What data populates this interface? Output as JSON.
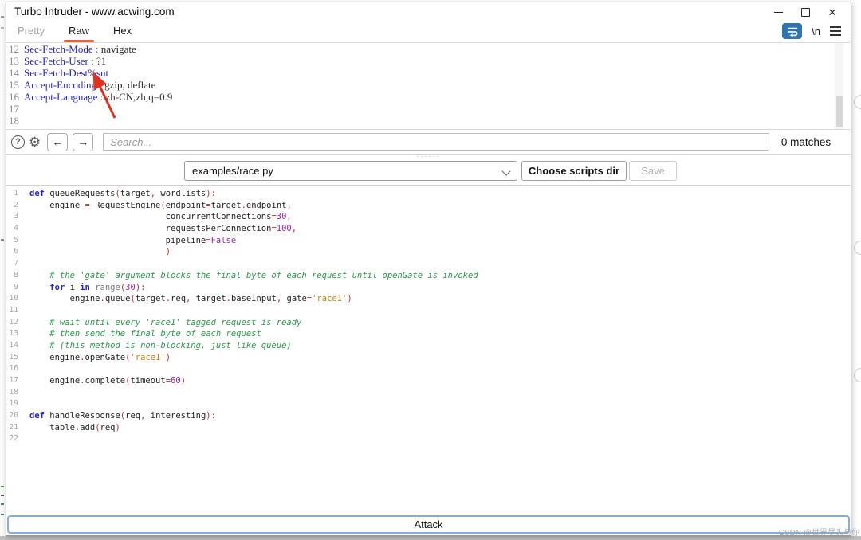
{
  "window": {
    "title": "Turbo Intruder - www.acwing.com"
  },
  "tabs": [
    {
      "label": "Pretty",
      "state": "dim"
    },
    {
      "label": "Raw",
      "state": "active"
    },
    {
      "label": "Hex",
      "state": "normal"
    }
  ],
  "toolbar": {
    "newline_label": "\\n"
  },
  "request_editor": {
    "lines": [
      {
        "num": "12",
        "name": "Sec-Fetch-Mode",
        "sep": " : ",
        "value": "navigate"
      },
      {
        "num": "13",
        "name": "Sec-Fetch-User",
        "sep": " : ",
        "value": "?1"
      },
      {
        "num": "14",
        "name": "Sec-Fetch-Dest%snt",
        "sep": "",
        "value": ""
      },
      {
        "num": "15",
        "name": "Accept-Encoding",
        "sep": " : ",
        "value": "gzip, deflate"
      },
      {
        "num": "16",
        "name": "Accept-Language",
        "sep": " : ",
        "value": "zh-CN,zh;q=0.9"
      },
      {
        "num": "17",
        "name": "",
        "sep": "",
        "value": ""
      },
      {
        "num": "18",
        "name": "",
        "sep": "",
        "value": ""
      }
    ]
  },
  "search": {
    "placeholder": "Search...",
    "matches_label": "0 matches",
    "help_glyph": "?"
  },
  "script_bar": {
    "selected_script": "examples/race.py",
    "choose_button": "Choose scripts dir",
    "save_button": "Save"
  },
  "code_editor": {
    "lines": [
      [
        [
          "k",
          "def"
        ],
        [
          "t",
          " queueRequests"
        ],
        [
          "p",
          "("
        ],
        [
          "t",
          "target"
        ],
        [
          "p",
          ","
        ],
        [
          "t",
          " wordlists"
        ],
        [
          "p",
          "):"
        ]
      ],
      [
        [
          "t",
          "    engine "
        ],
        [
          "p",
          "="
        ],
        [
          "t",
          " RequestEngine"
        ],
        [
          "p",
          "("
        ],
        [
          "t",
          "endpoint"
        ],
        [
          "p",
          "="
        ],
        [
          "t",
          "target"
        ],
        [
          "p",
          "."
        ],
        [
          "t",
          "endpoint"
        ],
        [
          "p",
          ","
        ]
      ],
      [
        [
          "t",
          "                           concurrentConnections"
        ],
        [
          "p",
          "="
        ],
        [
          "n",
          "30"
        ],
        [
          "p",
          ","
        ]
      ],
      [
        [
          "t",
          "                           requestsPerConnection"
        ],
        [
          "p",
          "="
        ],
        [
          "n",
          "100"
        ],
        [
          "p",
          ","
        ]
      ],
      [
        [
          "t",
          "                           pipeline"
        ],
        [
          "p",
          "="
        ],
        [
          "n",
          "False"
        ]
      ],
      [
        [
          "t",
          "                           "
        ],
        [
          "p",
          ")"
        ]
      ],
      [],
      [
        [
          "c",
          "    # the 'gate' argument blocks the final byte of each request until openGate is invoked"
        ]
      ],
      [
        [
          "t",
          "    "
        ],
        [
          "k",
          "for"
        ],
        [
          "t",
          " i "
        ],
        [
          "k",
          "in"
        ],
        [
          "t",
          " "
        ],
        [
          "f",
          "range"
        ],
        [
          "p",
          "("
        ],
        [
          "n",
          "30"
        ],
        [
          "p",
          "):"
        ]
      ],
      [
        [
          "t",
          "        engine"
        ],
        [
          "p",
          "."
        ],
        [
          "t",
          "queue"
        ],
        [
          "p",
          "("
        ],
        [
          "t",
          "target"
        ],
        [
          "p",
          "."
        ],
        [
          "t",
          "req"
        ],
        [
          "p",
          ","
        ],
        [
          "t",
          " target"
        ],
        [
          "p",
          "."
        ],
        [
          "t",
          "baseInput"
        ],
        [
          "p",
          ","
        ],
        [
          "t",
          " gate"
        ],
        [
          "p",
          "="
        ],
        [
          "s",
          "'race1'"
        ],
        [
          "p",
          ")"
        ]
      ],
      [],
      [
        [
          "c",
          "    # wait until every 'race1' tagged request is ready"
        ]
      ],
      [
        [
          "c",
          "    # then send the final byte of each request"
        ]
      ],
      [
        [
          "c",
          "    # (this method is non-blocking, just like queue)"
        ]
      ],
      [
        [
          "t",
          "    engine"
        ],
        [
          "p",
          "."
        ],
        [
          "t",
          "openGate"
        ],
        [
          "p",
          "("
        ],
        [
          "s",
          "'race1'"
        ],
        [
          "p",
          ")"
        ]
      ],
      [],
      [
        [
          "t",
          "    engine"
        ],
        [
          "p",
          "."
        ],
        [
          "t",
          "complete"
        ],
        [
          "p",
          "("
        ],
        [
          "t",
          "timeout"
        ],
        [
          "p",
          "="
        ],
        [
          "n",
          "60"
        ],
        [
          "p",
          ")"
        ]
      ],
      [],
      [],
      [
        [
          "k",
          "def"
        ],
        [
          "t",
          " handleResponse"
        ],
        [
          "p",
          "("
        ],
        [
          "t",
          "req"
        ],
        [
          "p",
          ","
        ],
        [
          "t",
          " interesting"
        ],
        [
          "p",
          "):"
        ]
      ],
      [
        [
          "t",
          "    table"
        ],
        [
          "p",
          "."
        ],
        [
          "t",
          "add"
        ],
        [
          "p",
          "("
        ],
        [
          "t",
          "req"
        ],
        [
          "p",
          ")"
        ]
      ],
      []
    ]
  },
  "attack": {
    "label": "Attack"
  },
  "watermark": "CSDN @世界尽头与你",
  "colors": {
    "tab_underline": "#ec5f32",
    "header_name": "#2323c8",
    "keyword": "#2424cc",
    "punctuation": "#c23028",
    "number": "#9b26ad",
    "string": "#c28413",
    "comment": "#2a9a4a",
    "function": "#7a7a7a",
    "wrap_icon_bg": "#2e75b6",
    "attack_border": "#84aede",
    "annotation_arrow": "#e0301e"
  }
}
